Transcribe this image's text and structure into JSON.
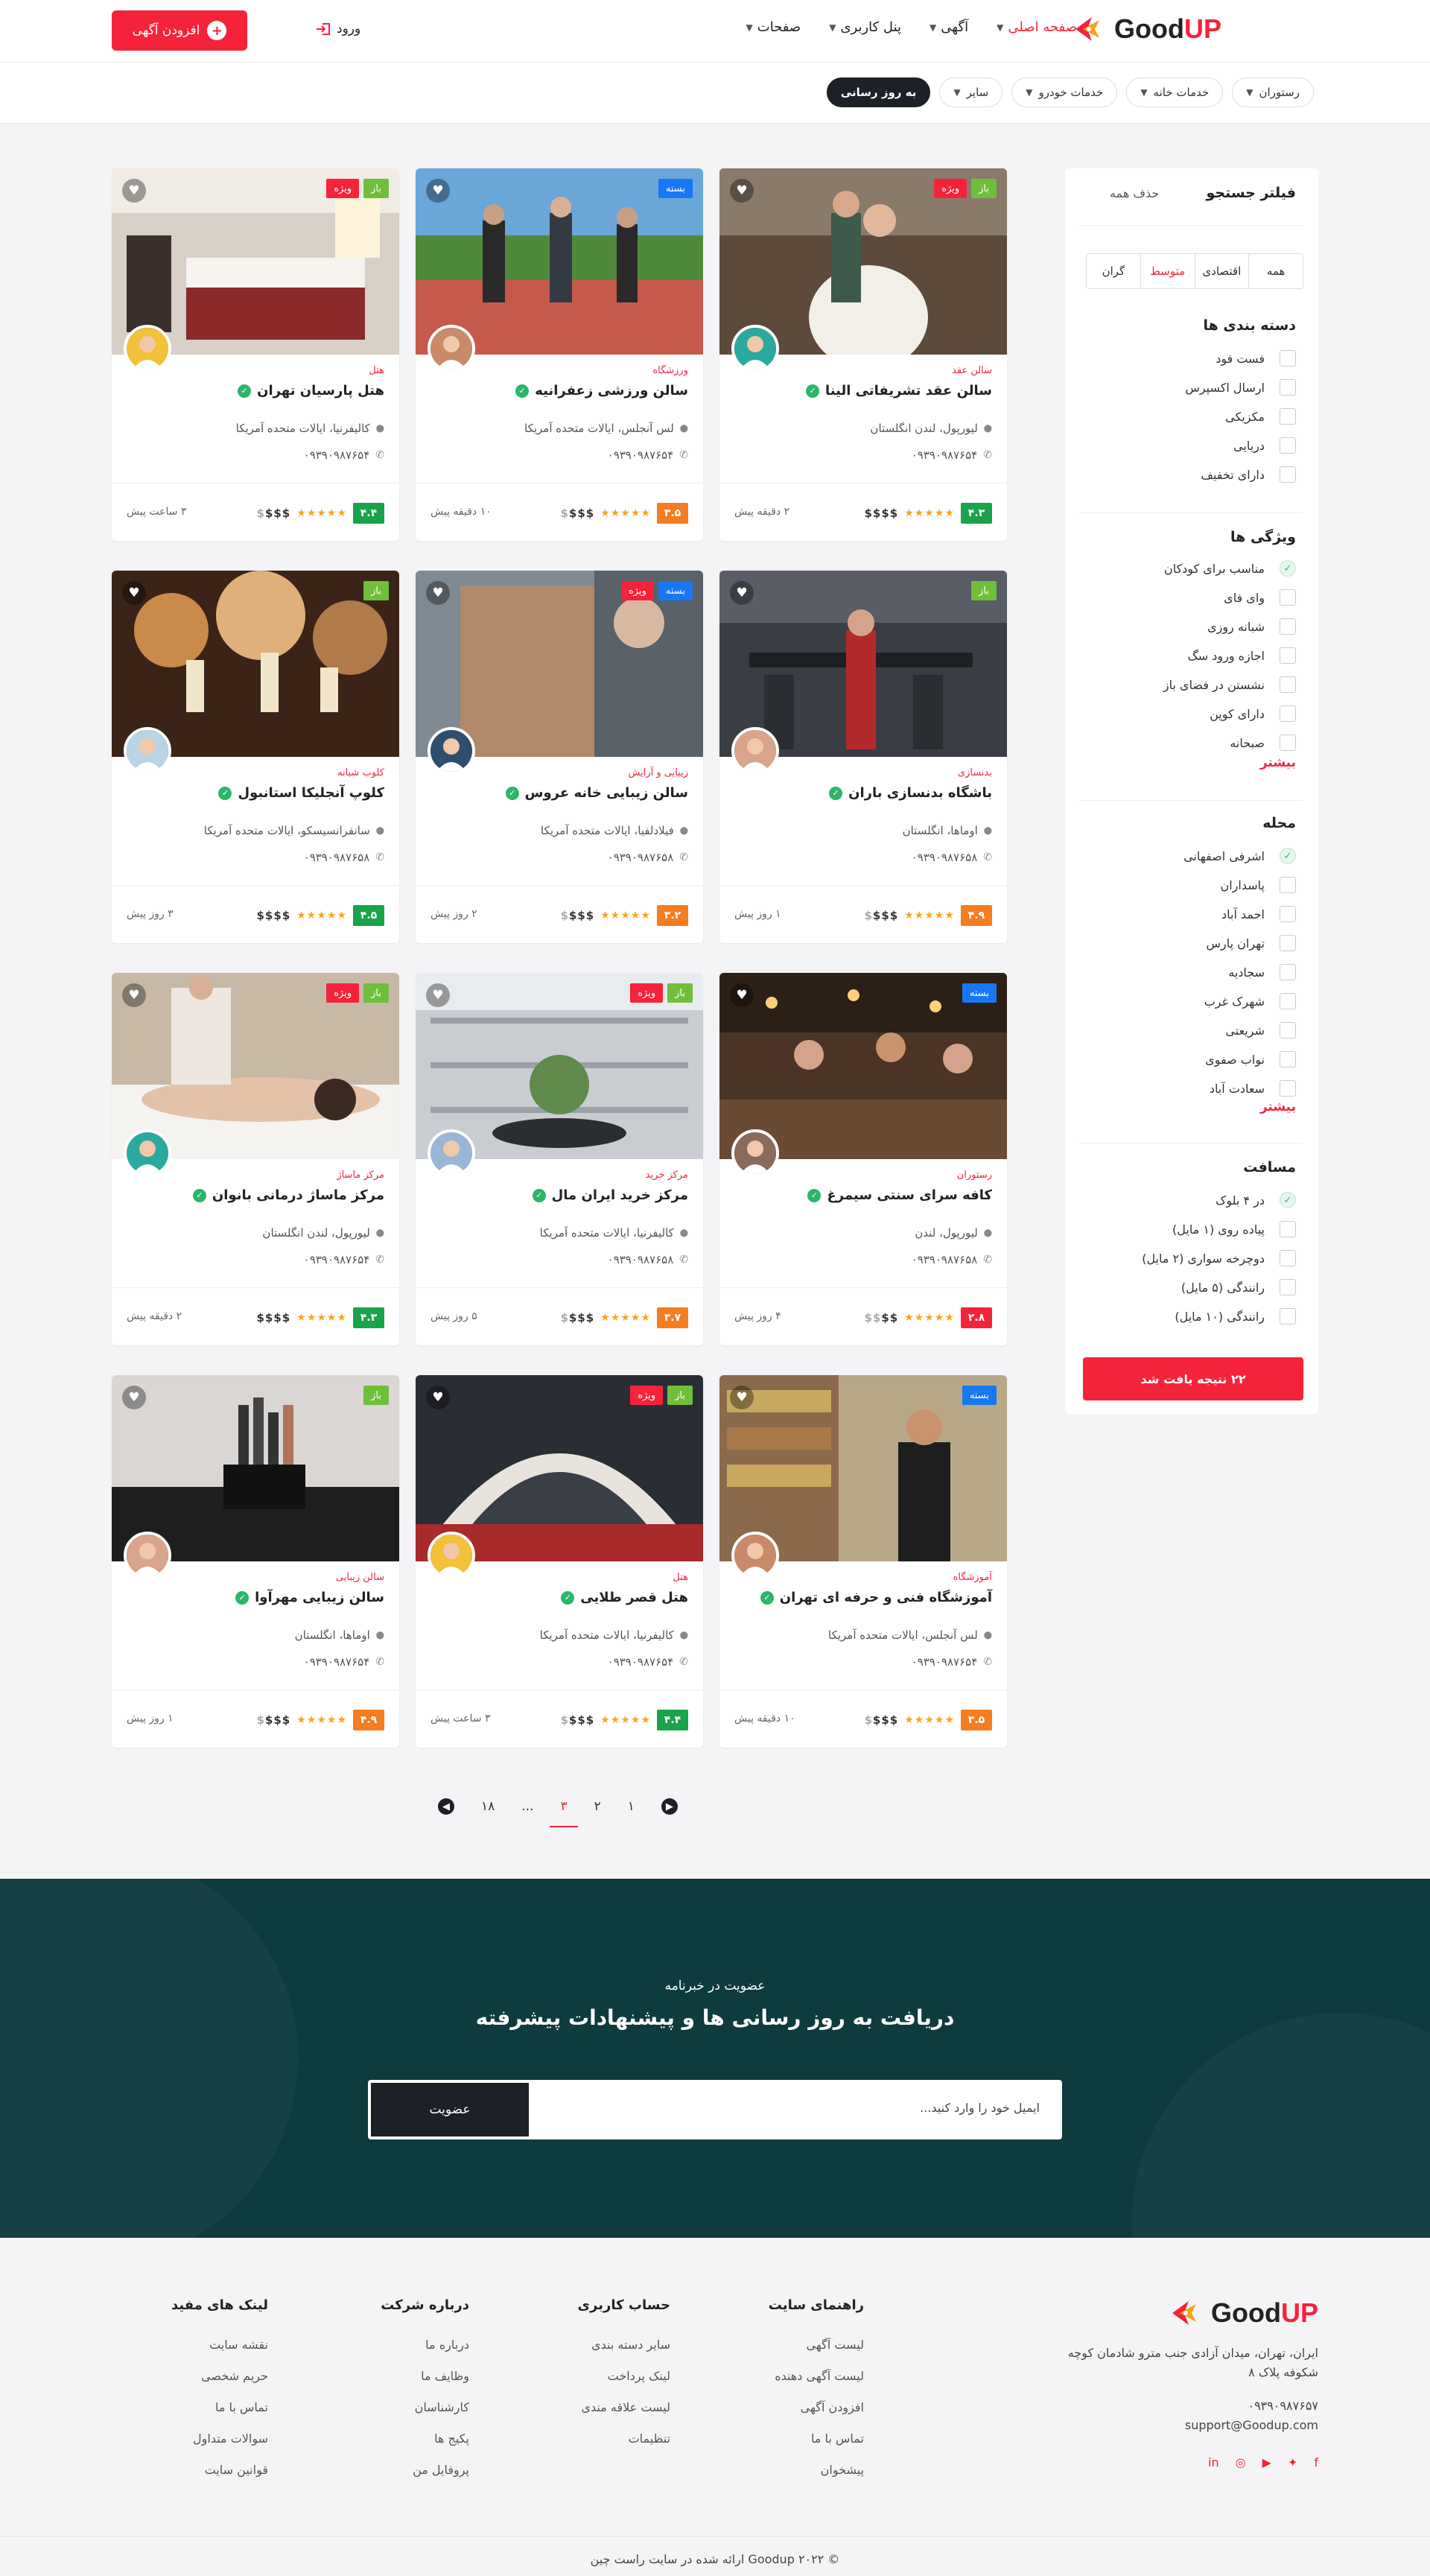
{
  "header": {
    "logo_text_good": "Good",
    "logo_text_up": "UP",
    "nav": [
      {
        "label": "صفحه اصلی",
        "active": true
      },
      {
        "label": "آگهی"
      },
      {
        "label": "پنل کاربری"
      },
      {
        "label": "صفحات"
      }
    ],
    "login_label": "ورود",
    "add_label": "افزودن آگهی"
  },
  "filters": {
    "chips": [
      "رستوران",
      "خدمات خانه",
      "خدمات خودرو",
      "سایر",
      "به روز رسانی"
    ]
  },
  "sidebar": {
    "title": "فیلتر جستجو",
    "clear": "حذف همه",
    "price": [
      "همه",
      "اقتصادی",
      "متوسط",
      "گران"
    ],
    "categories_title": "دسته بندی ها",
    "categories": [
      "فست فود",
      "ارسال اکسپرس",
      "مکزیکی",
      "دریایی",
      "دارای تخفیف"
    ],
    "features_title": "ویژگی ها",
    "features": [
      "مناسب برای کودکان",
      "وای فای",
      "شبانه روزی",
      "اجازه ورود سگ",
      "نشستن در فضای باز",
      "دارای کوپن",
      "صبحانه"
    ],
    "more": "بیشتر",
    "areas_title": "محله",
    "areas": [
      "اشرفی اصفهانی",
      "پاسداران",
      "احمد آباد",
      "تهران پارس",
      "سجادیه",
      "شهرک غرب",
      "شریعتی",
      "نواب صفوی",
      "سعادت آباد"
    ],
    "distance_title": "مسافت",
    "distances": [
      "در ۴ بلوک",
      "پیاده روی (۱ مایل)",
      "دوچرخه سواری (۲ مایل)",
      "رانندگی (۵ مایل)",
      "رانندگی (۱۰ مایل)"
    ],
    "result_button": "۲۲ نتیجه یافت شد"
  },
  "listings": [
    {
      "category": "سالن عقد",
      "title": "سالن عقد تشریفاتی الینا",
      "address": "لیورپول، لندن انگلستان",
      "phone": "۰۹۳۹۰۹۸۷۶۵۴",
      "score": "۴.۳",
      "score_color": "#1aa34a",
      "rating": 5,
      "price_level": 4,
      "price_text": "$$$$",
      "time": "۲ دقیقه پیش",
      "badges": [
        "باز",
        "ویژه"
      ],
      "scene": "wedding",
      "avatar": "#2aa9a0"
    },
    {
      "category": "ورزشگاه",
      "title": "سالن ورزشی زعفرانیه",
      "address": "لس آنجلس، ایالات متحده آمریکا",
      "phone": "۰۹۳۹۰۹۸۷۶۵۴",
      "score": "۳.۵",
      "score_color": "#f57c20",
      "rating": 5,
      "price_level": 3,
      "price_text": "$$$$",
      "time": "۱۰ دقیقه پیش",
      "badges": [
        "بسته"
      ],
      "scene": "sport",
      "avatar": "#c98a6a"
    },
    {
      "category": "هتل",
      "title": "هتل پارسیان تهران",
      "address": "کالیفرنیا، ایالات متحده آمریکا",
      "phone": "۰۹۳۹۰۹۸۷۶۵۴",
      "score": "۴.۴",
      "score_color": "#1aa34a",
      "rating": 5,
      "price_level": 3,
      "price_text": "$$$$",
      "time": "۳ ساعت پیش",
      "badges": [
        "باز",
        "ویژه"
      ],
      "scene": "hotel",
      "avatar": "#f3c13a"
    },
    {
      "category": "بدنسازی",
      "title": "باشگاه بدنسازی باران",
      "address": "اوماها، انگلستان",
      "phone": "۰۹۳۹۰۹۸۷۶۵۸",
      "score": "۴.۹",
      "score_color": "#f57c20",
      "rating": 5,
      "price_level": 3,
      "price_text": "$$$$",
      "time": "۱ روز پیش",
      "badges": [
        "باز"
      ],
      "scene": "gym",
      "avatar": "#d9a58a"
    },
    {
      "category": "زیبایی و آرایش",
      "title": "سالن زیبایی خانه عروس",
      "address": "فیلادلفیا، ایالات متحده آمریکا",
      "phone": "۰۹۳۹۰۹۸۷۶۵۸",
      "score": "۳.۲",
      "score_color": "#f57c20",
      "rating": 5,
      "price_level": 3,
      "price_text": "$$$$",
      "time": "۲ روز پیش",
      "badges": [
        "بسته",
        "ویژه"
      ],
      "scene": "salon",
      "avatar": "#2d4e6e"
    },
    {
      "category": "کلوب شبانه",
      "title": "کلوپ آنجلیکا استانبول",
      "address": "سانفرانسیسکو، ایالات متحده آمریکا",
      "phone": "۰۹۳۹۰۹۸۷۶۵۸",
      "score": "۴.۵",
      "score_color": "#1aa34a",
      "rating": 5,
      "price_level": 4,
      "price_text": "$$$$",
      "time": "۳ روز پیش",
      "badges": [
        "باز"
      ],
      "scene": "club",
      "avatar": "#b9d3e6"
    },
    {
      "category": "رستوران",
      "title": "کافه سرای سنتی سیمرغ",
      "address": "لیورپول، لندن",
      "phone": "۰۹۳۹۰۹۸۷۶۵۸",
      "score": "۲.۸",
      "score_color": "#f5233a",
      "rating": 5,
      "price_level": 2,
      "price_text": "$$$$",
      "time": "۴ روز پیش",
      "badges": [
        "بسته"
      ],
      "scene": "cafe",
      "avatar": "#8a6a5a"
    },
    {
      "category": "مرکز خرید",
      "title": "مرکز خرید ایران مال",
      "address": "کالیفرنیا، ایالات متحده آمریکا",
      "phone": "۰۹۳۹۰۹۸۷۶۵۸",
      "score": "۳.۷",
      "score_color": "#f57c20",
      "rating": 5,
      "price_level": 3,
      "price_text": "$$$$",
      "time": "۵ روز پیش",
      "badges": [
        "باز",
        "ویژه"
      ],
      "scene": "mall",
      "avatar": "#9ab6d6"
    },
    {
      "category": "مرکز ماساژ",
      "title": "مرکز ماساژ درمانی بانوان",
      "address": "لیورپول، لندن انگلستان",
      "phone": "۰۹۳۹۰۹۸۷۶۵۴",
      "score": "۴.۳",
      "score_color": "#1aa34a",
      "rating": 5,
      "price_level": 4,
      "price_text": "$$$$",
      "time": "۲ دقیقه پیش",
      "badges": [
        "باز",
        "ویژه"
      ],
      "scene": "spa",
      "avatar": "#2aa9a0"
    },
    {
      "category": "آموزشگاه",
      "title": "آموزشگاه فنی و حرفه ای تهران",
      "address": "لس آنجلس، ایالات متحده آمریکا",
      "phone": "۰۹۳۹۰۹۸۷۶۵۴",
      "score": "۳.۵",
      "score_color": "#f57c20",
      "rating": 5,
      "price_level": 3,
      "price_text": "$$$$",
      "time": "۱۰ دقیقه پیش",
      "badges": [
        "بسته"
      ],
      "scene": "store",
      "avatar": "#c98a6a"
    },
    {
      "category": "هتل",
      "title": "هتل قصر طلایی",
      "address": "کالیفرنیا، ایالات متحده آمریکا",
      "phone": "۰۹۳۹۰۹۸۷۶۵۴",
      "score": "۴.۴",
      "score_color": "#1aa34a",
      "rating": 5,
      "price_level": 3,
      "price_text": "$$$$",
      "time": "۳ ساعت پیش",
      "badges": [
        "باز",
        "ویژه"
      ],
      "scene": "arch",
      "avatar": "#f3c13a"
    },
    {
      "category": "سالن زیبایی",
      "title": "سالن زیبایی مهرآوا",
      "address": "اوماها، انگلستان",
      "phone": "۰۹۳۹۰۹۸۷۶۵۴",
      "score": "۴.۹",
      "score_color": "#f57c20",
      "rating": 5,
      "price_level": 3,
      "price_text": "$$$$",
      "time": "۱ روز پیش",
      "badges": [
        "باز"
      ],
      "scene": "makeup",
      "avatar": "#d9a58a"
    }
  ],
  "pagination": {
    "pages": [
      "۱",
      "۲",
      "۳",
      "...",
      "۱۸"
    ],
    "current": "۳"
  },
  "newsletter": {
    "subtitle": "عضویت در خبرنامه",
    "title": "دریافت به روز رسانی ها و پیشنهادات پیشرفته",
    "placeholder": "ایمیل خود را وارد کنید...",
    "button": "عضویت"
  },
  "footer": {
    "address": "ایران، تهران، میدان آزادی جنب مترو شادمان کوچه شکوفه پلاک ۸",
    "phone": "۰۹۳۹۰۹۸۷۶۵۷",
    "email": "support@Goodup.com",
    "columns": [
      {
        "title": "راهنمای سایت",
        "links": [
          "لیست آگهی",
          "لیست آگهی دهنده",
          "افزودن آگهی",
          "تماس با ما",
          "پیشخوان"
        ]
      },
      {
        "title": "حساب کاربری",
        "links": [
          "سایر دسته بندی",
          "لینک پرداخت",
          "لیست علاقه مندی",
          "تنظیمات"
        ]
      },
      {
        "title": "درباره شرکت",
        "links": [
          "درباره ما",
          "وظایف ما",
          "کارشناسان",
          "پکیج ها",
          "پروفایل من"
        ]
      },
      {
        "title": "لینک های مفید",
        "links": [
          "نقشه سایت",
          "حریم شخصی",
          "تماس با ما",
          "سوالات متداول",
          "قوانین سایت"
        ]
      }
    ],
    "copyright": "© ۲۰۲۲ Goodup ارائه شده در سایت راست چین"
  },
  "colors": {
    "accent": "#f5233a",
    "dark": "#1c2127",
    "newsletter_bg": "#0d3b3e",
    "open": "#6fbf3b",
    "closed": "#1877f2"
  }
}
